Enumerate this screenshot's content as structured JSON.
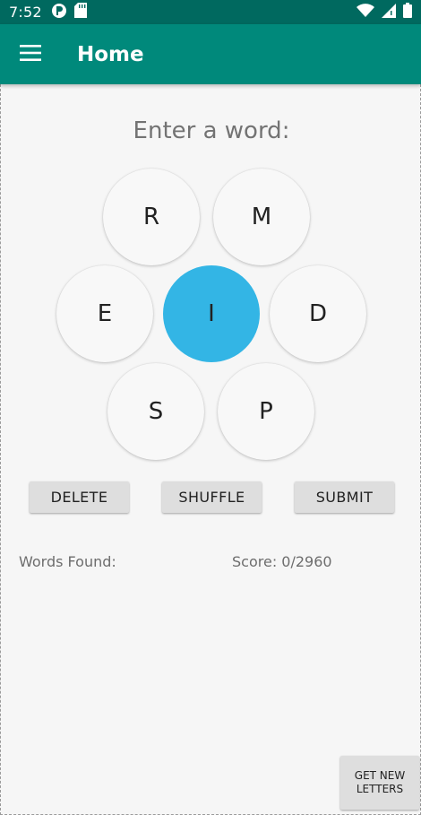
{
  "status_bar": {
    "time": "7:52",
    "icons_left": [
      "app-notification-icon",
      "sd-card-icon"
    ],
    "icons_right": [
      "wifi-icon",
      "cellular-signal-icon",
      "battery-icon"
    ]
  },
  "app_bar": {
    "title": "Home",
    "menu_icon": "hamburger-menu-icon"
  },
  "game": {
    "prompt": "Enter a word:",
    "letters": {
      "top_left": "R",
      "top_right": "M",
      "middle_left": "E",
      "center": "I",
      "middle_right": "D",
      "bottom_left": "S",
      "bottom_right": "P"
    },
    "buttons": {
      "delete": "DELETE",
      "shuffle": "SHUFFLE",
      "submit": "SUBMIT",
      "get_new_letters": "GET NEW LETTERS"
    },
    "words_found_label": "Words Found:",
    "score_text": "Score: 0/2960",
    "colors": {
      "status_bar": "#00695f",
      "app_bar": "#00897b",
      "center_letter": "#33b5e5"
    }
  }
}
